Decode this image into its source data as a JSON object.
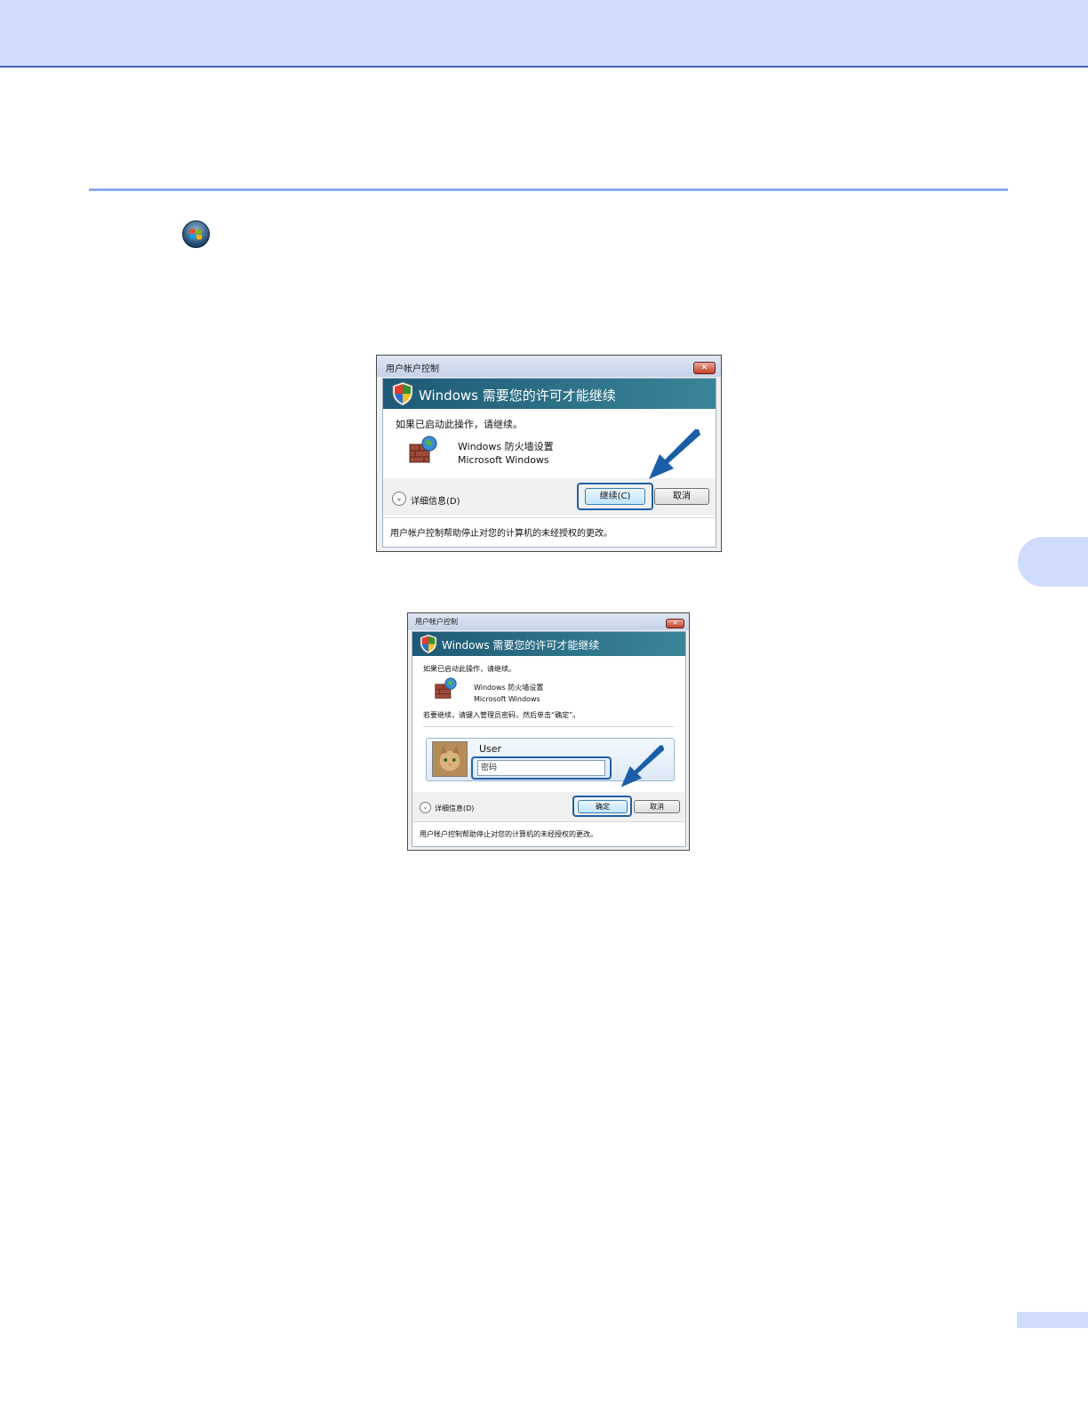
{
  "dialog1": {
    "title": "用户帐户控制",
    "close": "✕",
    "banner": "Windows 需要您的许可才能继续",
    "prompt": "如果已启动此操作，请继续。",
    "program_name": "Windows 防火墙设置",
    "publisher": "Microsoft Windows",
    "details": "详细信息(D)",
    "continue_button": "继续(C)",
    "cancel_button": "取消",
    "footer": "用户帐户控制帮助停止对您的计算机的未经授权的更改。"
  },
  "dialog2": {
    "title": "用户帐户控制",
    "close": "✕",
    "banner": "Windows 需要您的许可才能继续",
    "prompt": "如果已启动此操作，请继续。",
    "program_name": "Windows 防火墙设置",
    "publisher": "Microsoft Windows",
    "instruction": "若要继续，请键入管理员密码，然后单击“确定”。",
    "user_name": "User",
    "password_placeholder": "密码",
    "details": "详细信息(D)",
    "ok_button": "确定",
    "cancel_button": "取消",
    "footer": "用户帐户控制帮助停止对您的计算机的未经授权的更改。"
  },
  "colors": {
    "banner_bg": "#cfdcfb",
    "rule": "#8eaaea",
    "arrow": "#1a5ea8"
  }
}
